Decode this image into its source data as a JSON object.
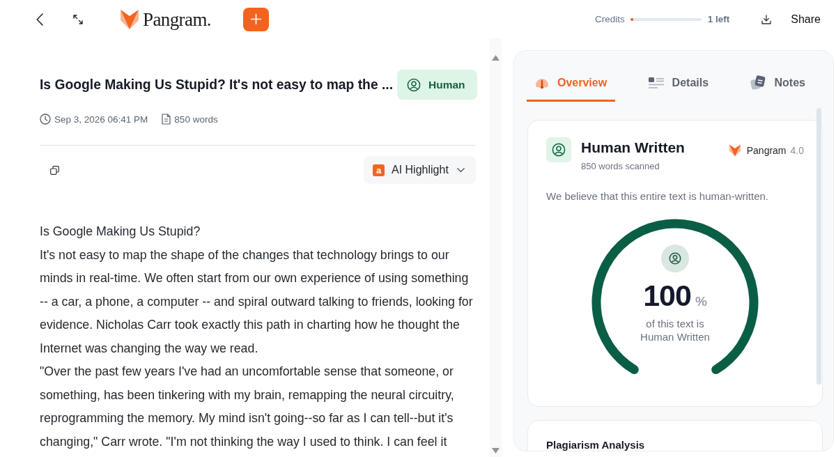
{
  "top_bar": {
    "logo_text": "Pangram.",
    "credits": {
      "label": "Credits",
      "level": 0.04,
      "reading": "1 left"
    },
    "share_label": "Share"
  },
  "document": {
    "title": "Is Google Making Us Stupid? It's not easy to map the ...",
    "verdict_badge": "Human",
    "date": "Sep 3, 2026 06:41 PM",
    "word_count": "850 words",
    "highlight_menu": {
      "badge": "a",
      "label": "AI Highlight"
    },
    "paragraphs": [
      "Is Google Making Us Stupid?",
      "It's not easy to map the shape of the changes that technology brings to our minds in real-time. We often start from our own experience of using something -- a car, a phone, a computer -- and spiral outward talking to friends, looking for evidence. Nicholas Carr took exactly this path in charting how he thought the Internet was changing the way we read.",
      "\"Over the past few years I've had an uncomfortable sense that someone, or something, has been tinkering with my brain, remapping the neural circuitry, reprogramming the memory. My mind isn't going--so far as I can tell--but it's changing,\" Carr wrote. \"I'm not thinking the way I used to think. I can feel it"
    ]
  },
  "panel": {
    "tabs": [
      {
        "label": "Overview",
        "selected": true,
        "kind": "gauge"
      },
      {
        "label": "Details",
        "selected": false,
        "kind": "list"
      },
      {
        "label": "Notes",
        "selected": false,
        "kind": "cards"
      }
    ],
    "result_card": {
      "title": "Human Written",
      "subtitle": "850 words scanned",
      "model_name": "Pangram",
      "model_version": "4.0",
      "summary": "We believe that this entire text is human-written.",
      "gauge": {
        "level": 1,
        "value": "100",
        "unit": "%",
        "caption": "of this text is Human Written"
      }
    },
    "next_card": {
      "title": "Plagiarism Analysis"
    }
  }
}
